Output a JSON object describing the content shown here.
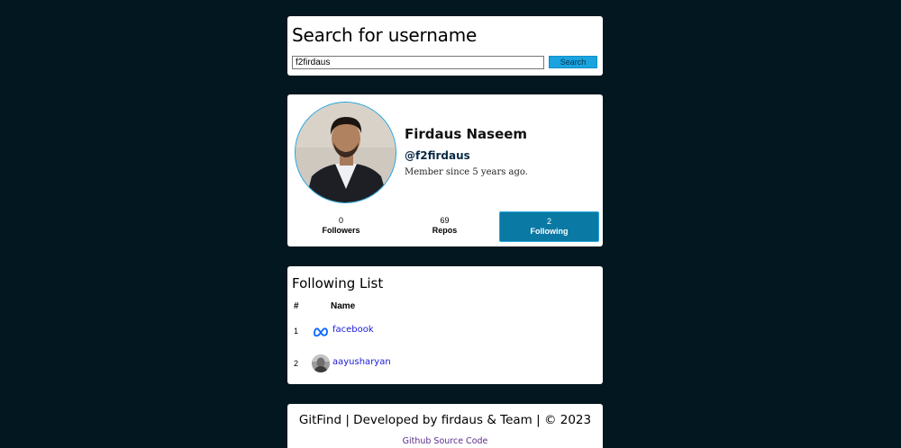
{
  "search": {
    "title": "Search for username",
    "input_value": "f2firdaus",
    "button_label": "Search"
  },
  "profile": {
    "name": "Firdaus Naseem",
    "username": "@f2firdaus",
    "member_since": "Member since 5 years ago.",
    "stats": [
      {
        "value": "0",
        "label": "Followers"
      },
      {
        "value": "69",
        "label": "Repos"
      },
      {
        "value": "2",
        "label": "Following"
      }
    ],
    "active_tab": "Following",
    "accent_color": "#0a7aa5"
  },
  "following": {
    "title": "Following List",
    "headers": [
      "#",
      "Name"
    ],
    "rows": [
      {
        "index": "1",
        "name": "facebook",
        "icon": "meta-logo-icon"
      },
      {
        "index": "2",
        "name": "aayusharyan",
        "icon": "user-avatar-icon"
      }
    ]
  },
  "footer": {
    "text": "GitFind | Developed by firdaus & Team | © 2023",
    "link": "Github Source Code"
  }
}
